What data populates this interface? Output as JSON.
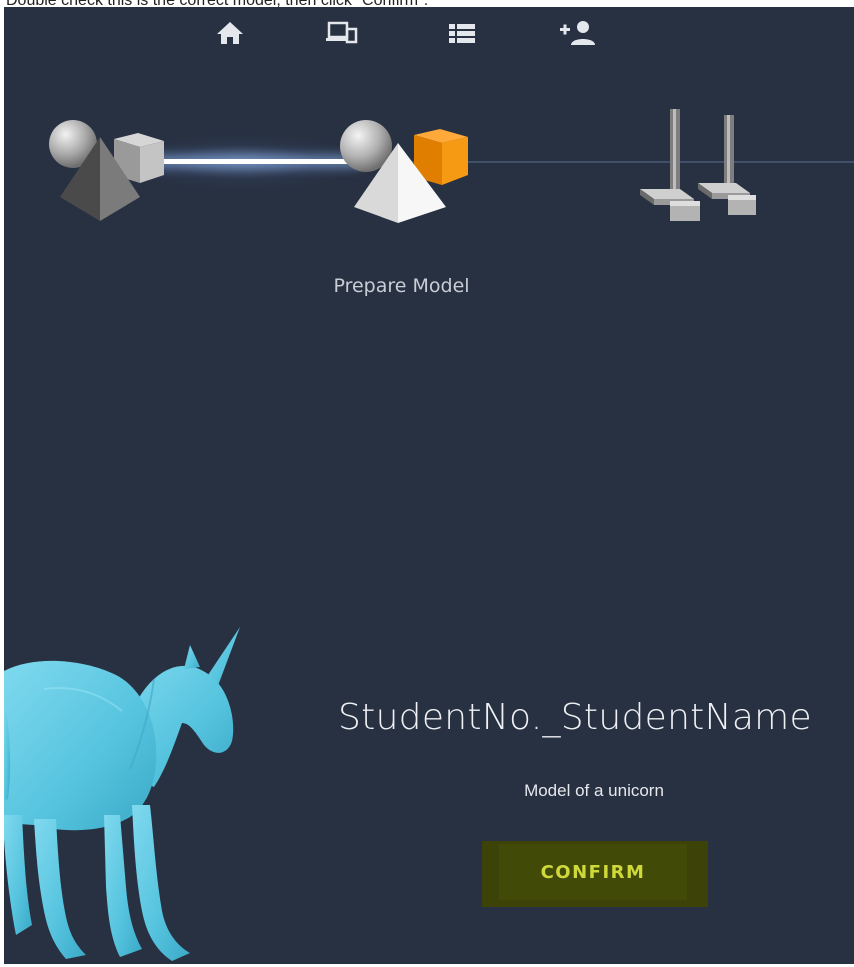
{
  "instruction": {
    "text": "Double check this is the correct model, then click \"Confirm\"."
  },
  "nav": {
    "items": [
      {
        "icon": "home-icon"
      },
      {
        "icon": "devices-icon"
      },
      {
        "icon": "list-icon"
      },
      {
        "icon": "add-user-icon"
      }
    ]
  },
  "progress": {
    "current_step_label": "Prepare Model"
  },
  "model": {
    "title": "StudentNo._StudentName",
    "description": "Model of a unicorn",
    "confirm_label": "CONFIRM"
  },
  "colors": {
    "background": "#283142",
    "nav_icon": "#e4e7ec",
    "accent_orange": "#f08c00",
    "model_cyan": "#5ec9e3",
    "button_bg": "#424a08",
    "button_text": "#cfd93a"
  }
}
